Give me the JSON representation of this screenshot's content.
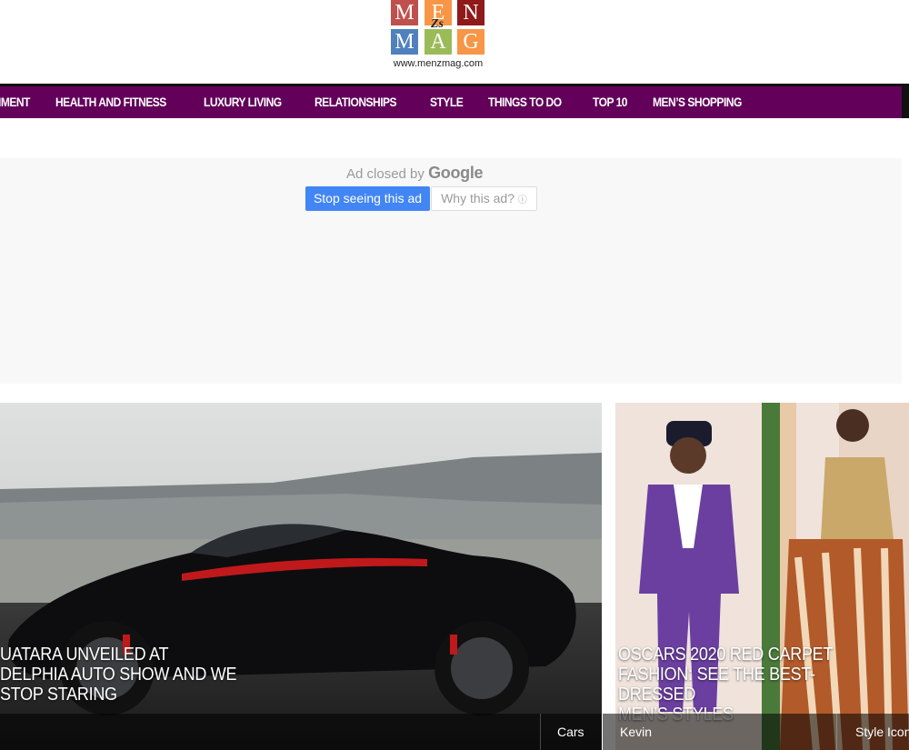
{
  "logo": {
    "letters": [
      "M",
      "E",
      "N",
      "M",
      "A",
      "G"
    ],
    "zs": "Zs",
    "url": "www.menzmag.com",
    "colors": [
      "#c0504d",
      "#f79646",
      "#8e1a1a",
      "#4f81bd",
      "#9bbb59",
      "#f79646"
    ]
  },
  "nav": {
    "items": [
      "IMENT",
      "HEALTH AND FITNESS",
      "LUXURY LIVING",
      "RELATIONSHIPS",
      "STYLE",
      "THINGS TO DO",
      "TOP 10",
      "MEN’S SHOPPING"
    ],
    "background": "#63005a"
  },
  "ad": {
    "closed_text": "Ad closed by",
    "google": "Google",
    "stop_label": "Stop seeing this ad",
    "why_label": "Why this ad?",
    "accent": "#4285f4"
  },
  "articles": [
    {
      "headline_lines": [
        "UATARA UNVEILED AT",
        "DELPHIA AUTO SHOW AND WE",
        "STOP STARING"
      ],
      "category": "Cars",
      "author": ""
    },
    {
      "headline_lines": [
        "OSCARS 2020 RED CARPET",
        "FASHION: SEE THE BEST-DRESSED",
        "MEN’S STYLES"
      ],
      "category": "Style Icon",
      "author": "Kevin"
    }
  ]
}
